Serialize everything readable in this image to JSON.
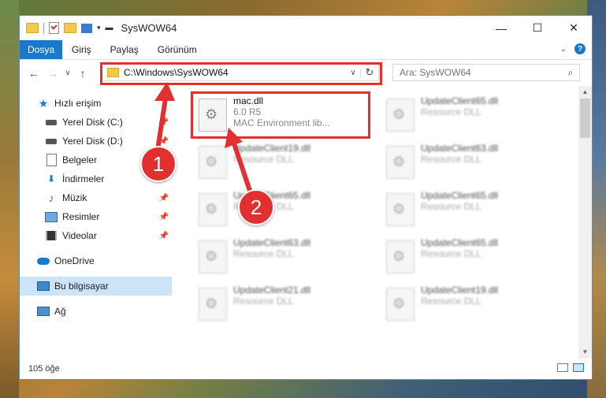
{
  "window": {
    "title": "SysWOW64",
    "controls": {
      "minimize": "—",
      "maximize": "☐",
      "close": "✕"
    }
  },
  "ribbon": {
    "tabs": [
      "Dosya",
      "Giriş",
      "Paylaş",
      "Görünüm"
    ]
  },
  "address": {
    "path": "C:\\Windows\\SysWOW64",
    "search_placeholder": "Ara: SysWOW64"
  },
  "nav": {
    "items": [
      {
        "label": "Hızlı erişim",
        "icon": "star-icon",
        "pinned": false,
        "selected": false
      },
      {
        "label": "Yerel Disk (C:)",
        "icon": "disk-icon",
        "pinned": true,
        "selected": false
      },
      {
        "label": "Yerel Disk (D:)",
        "icon": "disk-icon",
        "pinned": true,
        "selected": false
      },
      {
        "label": "Belgeler",
        "icon": "documents-icon",
        "pinned": true,
        "selected": false
      },
      {
        "label": "İndirmeler",
        "icon": "downloads-icon",
        "pinned": true,
        "selected": false
      },
      {
        "label": "Müzik",
        "icon": "music-icon",
        "pinned": true,
        "selected": false
      },
      {
        "label": "Resimler",
        "icon": "pictures-icon",
        "pinned": true,
        "selected": false
      },
      {
        "label": "Videolar",
        "icon": "videos-icon",
        "pinned": true,
        "selected": false
      },
      {
        "label": "OneDrive",
        "icon": "onedrive-icon",
        "pinned": false,
        "selected": false
      },
      {
        "label": "Bu bilgisayar",
        "icon": "this-pc-icon",
        "pinned": false,
        "selected": true
      },
      {
        "label": "Ağ",
        "icon": "network-icon",
        "pinned": false,
        "selected": false
      }
    ]
  },
  "files": {
    "items": [
      {
        "name": "mac.dll",
        "line2": "6.0 R5",
        "line3": "MAC Environment lib...",
        "blurred": false
      },
      {
        "name": "UpdateClient65.dll",
        "line2": "Resource DLL",
        "blurred": true
      },
      {
        "name": "UpdateClient19.dll",
        "line2": "Resource DLL",
        "blurred": true
      },
      {
        "name": "UpdateClient63.dll",
        "line2": "Resource DLL",
        "blurred": true
      },
      {
        "name": "UpdateClient65.dll",
        "line2": "Resource DLL",
        "blurred": true
      },
      {
        "name": "UpdateClient65.dll",
        "line2": "Resource DLL",
        "blurred": true
      },
      {
        "name": "UpdateClient63.dll",
        "line2": "Resource DLL",
        "blurred": true
      },
      {
        "name": "UpdateClient65.dll",
        "line2": "Resource DLL",
        "blurred": true
      },
      {
        "name": "UpdateClient21.dll",
        "line2": "Resource DLL",
        "blurred": true
      },
      {
        "name": "UpdateClient19.dll",
        "line2": "Resource DLL",
        "blurred": true
      }
    ]
  },
  "status": {
    "count": "105 öğe"
  },
  "annotations": {
    "badge1": "1",
    "badge2": "2",
    "color": "#e03030"
  }
}
